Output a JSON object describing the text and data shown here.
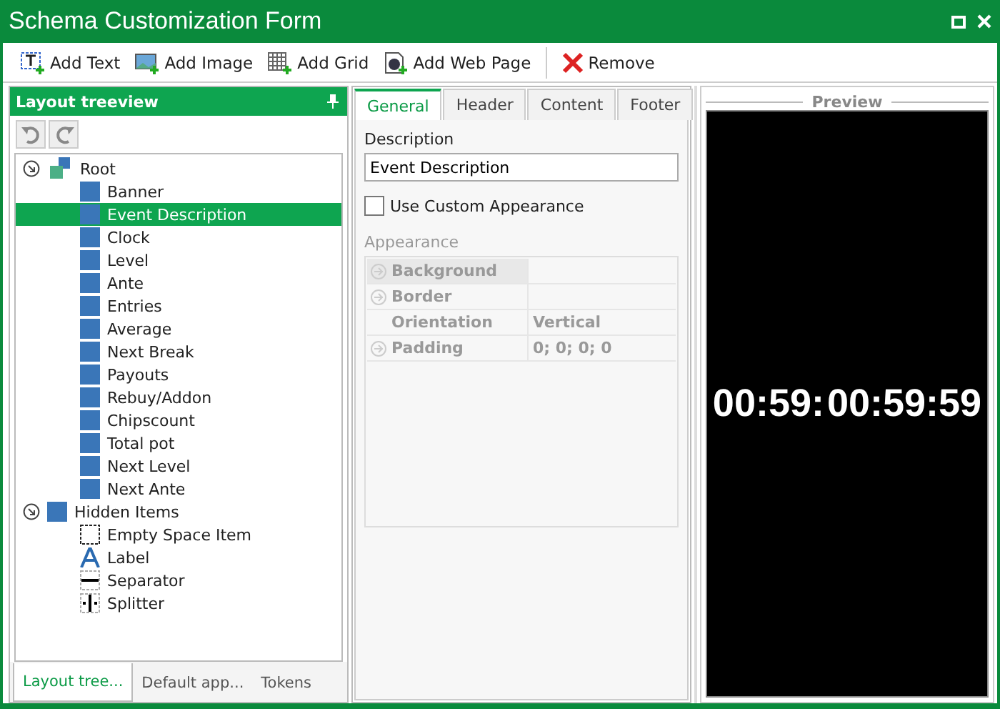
{
  "window": {
    "title": "Schema Customization Form"
  },
  "toolbar": [
    {
      "label": "Add Text",
      "kind": "text"
    },
    {
      "label": "Add Image",
      "kind": "image"
    },
    {
      "label": "Add Grid",
      "kind": "grid"
    },
    {
      "label": "Add Web Page",
      "kind": "web"
    },
    {
      "label": "Remove",
      "kind": "remove"
    }
  ],
  "treeview": {
    "title": "Layout treeview",
    "nodes": [
      {
        "label": "Root",
        "kind": "group",
        "expanded": true,
        "selected": false,
        "children": [
          {
            "label": "Banner",
            "kind": "item",
            "selected": false
          },
          {
            "label": "Event Description",
            "kind": "item",
            "selected": true
          },
          {
            "label": "Clock",
            "kind": "item",
            "selected": false
          },
          {
            "label": "Level",
            "kind": "item",
            "selected": false
          },
          {
            "label": "Ante",
            "kind": "item",
            "selected": false
          },
          {
            "label": "Entries",
            "kind": "item",
            "selected": false
          },
          {
            "label": "Average",
            "kind": "item",
            "selected": false
          },
          {
            "label": "Next Break",
            "kind": "item",
            "selected": false
          },
          {
            "label": "Payouts",
            "kind": "item",
            "selected": false
          },
          {
            "label": "Rebuy/Addon",
            "kind": "item",
            "selected": false
          },
          {
            "label": "Chipscount",
            "kind": "item",
            "selected": false
          },
          {
            "label": "Total pot",
            "kind": "item",
            "selected": false
          },
          {
            "label": "Next Level",
            "kind": "item",
            "selected": false
          },
          {
            "label": "Next Ante",
            "kind": "item",
            "selected": false
          }
        ]
      },
      {
        "label": "Hidden Items",
        "kind": "item",
        "expanded": true,
        "selected": false,
        "children": [
          {
            "label": "Empty Space Item",
            "kind": "empty",
            "selected": false
          },
          {
            "label": "Label",
            "kind": "label",
            "selected": false
          },
          {
            "label": "Separator",
            "kind": "separator",
            "selected": false
          },
          {
            "label": "Splitter",
            "kind": "splitter",
            "selected": false
          }
        ]
      }
    ],
    "bottom_tabs": [
      {
        "label": "Layout tree...",
        "selected": true
      },
      {
        "label": "Default app...",
        "selected": false
      },
      {
        "label": "Tokens",
        "selected": false
      }
    ]
  },
  "properties": {
    "tabs": [
      {
        "label": "General",
        "selected": true
      },
      {
        "label": "Header",
        "selected": false
      },
      {
        "label": "Content",
        "selected": false
      },
      {
        "label": "Footer",
        "selected": false
      }
    ],
    "description_label": "Description",
    "description": "Event Description",
    "custom_appearance": {
      "label": "Use Custom Appearance",
      "checked": false
    },
    "appearance_label": "Appearance",
    "appearance": [
      {
        "name": "Background",
        "expandable": true
      },
      {
        "name": "Border",
        "expandable": true
      },
      {
        "name": "Orientation",
        "value": "Vertical",
        "expandable": false
      },
      {
        "name": "Padding",
        "value": "0; 0; 0; 0",
        "expandable": true
      }
    ]
  },
  "preview": {
    "title": "Preview",
    "clocks": [
      "00:59:",
      "00:59:59"
    ]
  }
}
